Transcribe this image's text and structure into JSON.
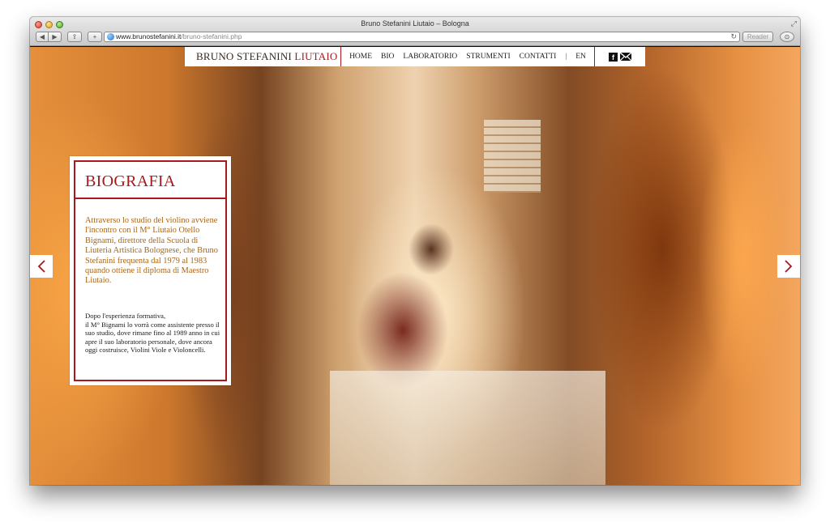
{
  "browser": {
    "window_title": "Bruno Stefanini Liutaio – Bologna",
    "url_host": "www.brunostefanini.it",
    "url_path": "/bruno-stefanini.php",
    "reader_label": "Reader",
    "back_icon": "◀",
    "forward_icon": "▶",
    "share_icon": "⇪",
    "add_icon": "+",
    "reload_icon": "↻",
    "fullscreen_icon": "⤢",
    "download_icon": "⊙"
  },
  "site": {
    "brand_main": "BRUNO STEFANINI",
    "brand_accent": "LIUTAIO",
    "accent_color": "#a8181c",
    "nav": {
      "home": "HOME",
      "bio": "BIO",
      "laboratorio": "LABORATORIO",
      "strumenti": "STRUMENTI",
      "contatti": "CONTATTI",
      "divider": "|",
      "lang": "EN"
    },
    "social": {
      "facebook_glyph": "f"
    }
  },
  "biography": {
    "title": "BIOGRAFIA",
    "intro": "Attraverso lo studio del violino avviene l'incontro con il M° Liutaio Otello Bignami, direttore della Scuola di Liuteria Artistica Bolognese, che Bruno Stefanini frequenta dal 1979 al 1983 quando ottiene il diploma di Maestro Liutaio.",
    "body_line1": "Dopo l'esperienza formativa,",
    "body_rest": "il M° Bignami lo vorrà come assistente presso il suo studio, dove rimane fino al 1989 anno in cui apre il suo laboratorio personale, dove ancora oggi costruisce, Violini Viole e Violoncelli."
  }
}
